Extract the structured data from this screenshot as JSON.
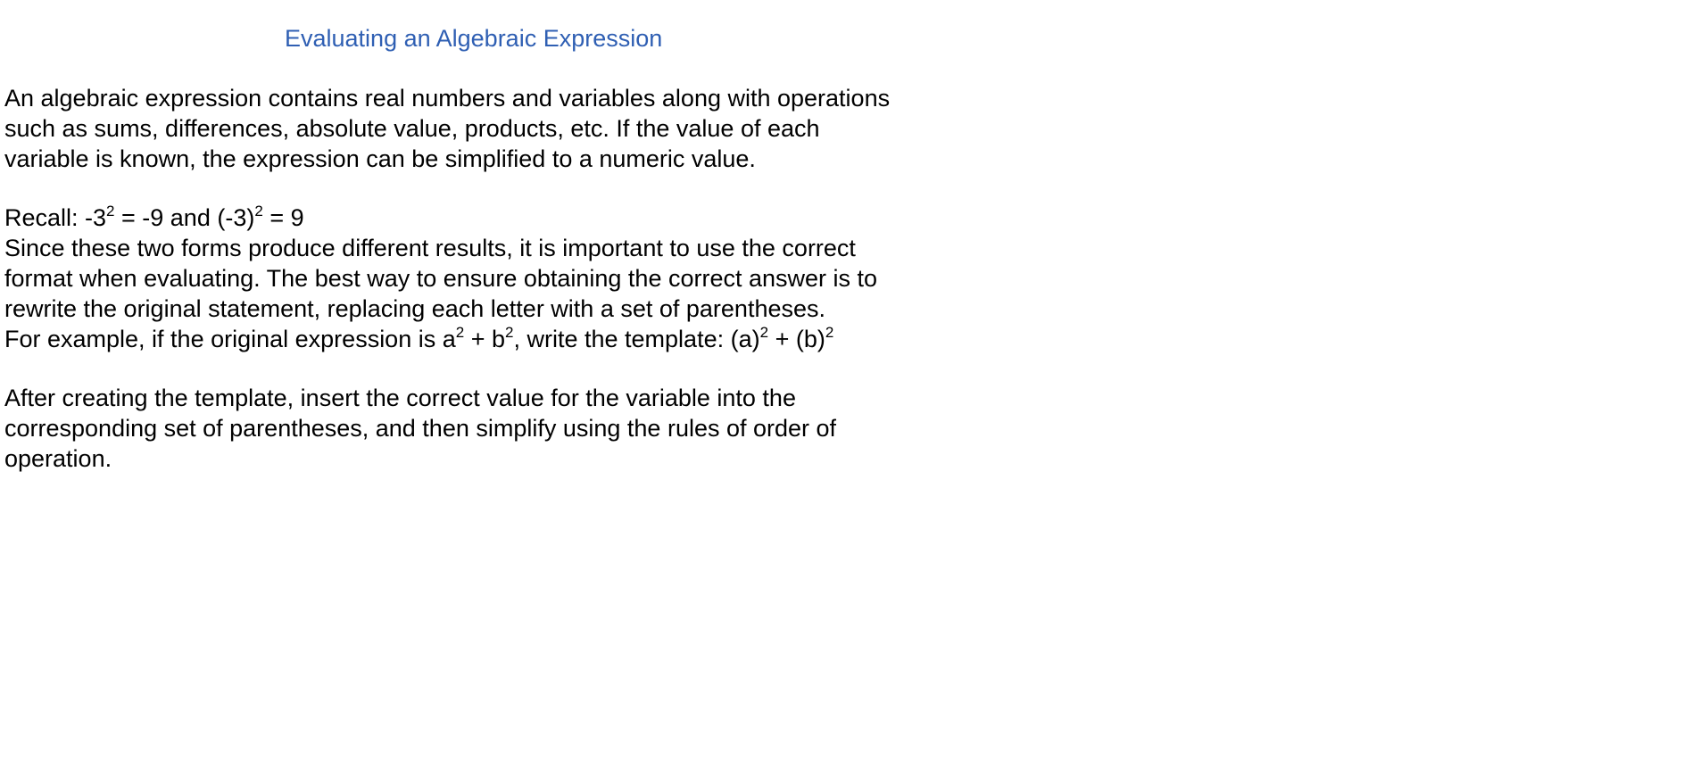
{
  "document": {
    "title": "Evaluating an Algebraic Expression",
    "title_color": "#2f5fb3",
    "intro_lines": [
      "An algebraic expression contains real numbers and variables along with operations",
      "such as sums, differences, absolute value, products, etc.  If the value of each",
      "variable is known, the expression can be simplified to a numeric value."
    ],
    "recall": {
      "label": "Recall:  ",
      "expr1_base": "-3",
      "expr1_exp": "2",
      "expr1_rest": " = -9  and  ",
      "expr2_base": "(-3)",
      "expr2_exp": "2",
      "expr2_rest": " = 9"
    },
    "body_lines": [
      "Since these two forms produce different results, it is important to use the correct",
      "format when evaluating.  The best way to ensure obtaining the correct answer is to",
      "rewrite the original statement, replacing each letter with a set of parentheses."
    ],
    "example": {
      "prefix": "For example, if the original expression is a",
      "exp1": "2",
      "mid1": " + b",
      "exp2": "2",
      "mid2": ", write the template:  (a)",
      "exp3": "2",
      "mid3": " + (b)",
      "exp4": "2"
    },
    "closing_lines": [
      "After creating the template, insert the correct value for the variable into the",
      "corresponding set of parentheses, and then simplify using the rules of order of",
      "operation."
    ]
  }
}
